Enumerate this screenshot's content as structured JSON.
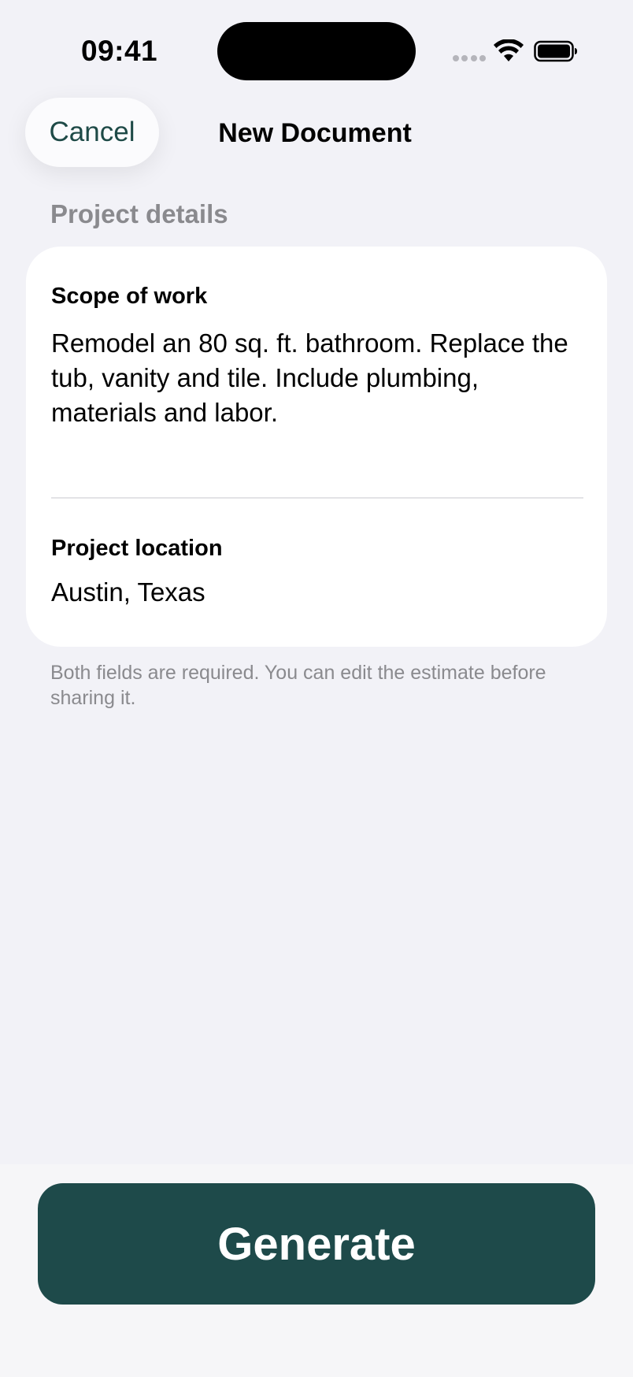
{
  "status_bar": {
    "time": "09:41",
    "icons": [
      "signal-icon",
      "wifi-icon",
      "battery-icon"
    ]
  },
  "nav": {
    "cancel_label": "Cancel",
    "title": "New Document"
  },
  "section": {
    "header": "Project details"
  },
  "form": {
    "scope": {
      "label": "Scope of work",
      "value": "Remodel an 80 sq. ft. bathroom. Replace the tub, vanity and tile. Include plumbing, materials and labor."
    },
    "location": {
      "label": "Project location",
      "value": "Austin, Texas"
    }
  },
  "helper_text": "Both fields are required. You can edit the estimate before sharing it.",
  "actions": {
    "generate_label": "Generate"
  },
  "colors": {
    "accent": "#1e4a4a",
    "background": "#f2f2f7",
    "secondary_text": "#8a8a8e"
  }
}
